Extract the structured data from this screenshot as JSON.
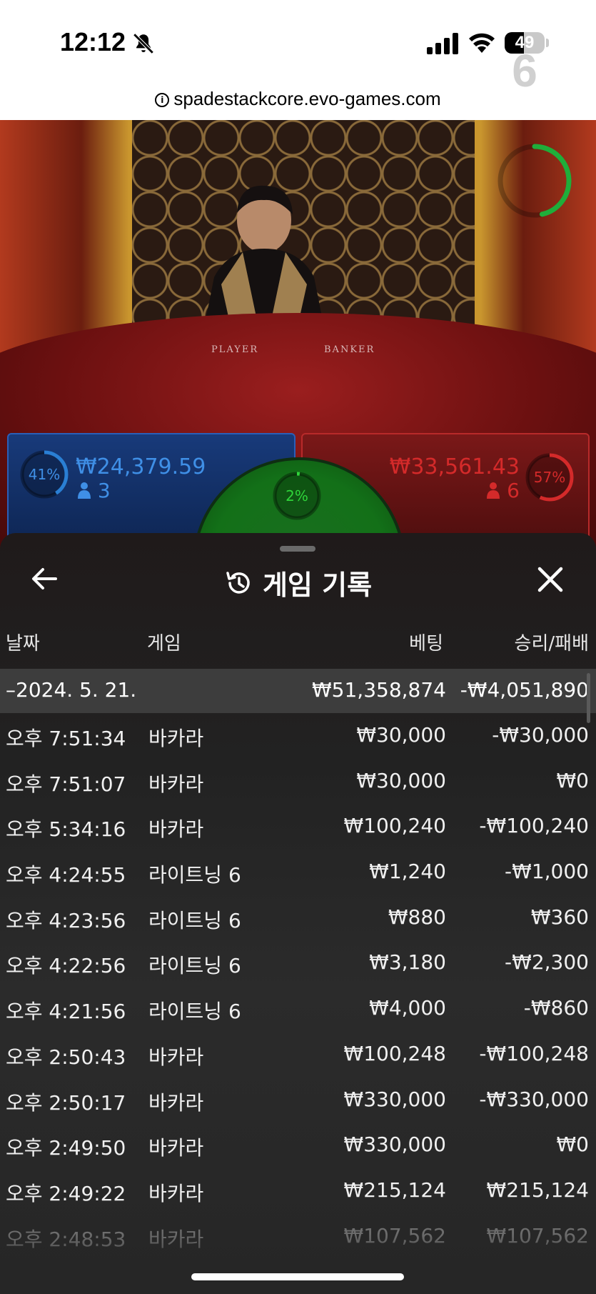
{
  "status_bar": {
    "time": "12:12",
    "battery": "49",
    "battery_level": 0.49
  },
  "browser": {
    "url": "spadestackcore.evo-games.com"
  },
  "video": {
    "countdown": "6",
    "table_labels": [
      "PLAYER",
      "BANKER"
    ]
  },
  "bets": {
    "player": {
      "percent": "41%",
      "amount": "₩24,379.59",
      "count": "3",
      "fraction": 0.41,
      "color": "#2a7fd4"
    },
    "tie": {
      "percent": "2%",
      "fraction": 0.02,
      "color": "#2fd43a"
    },
    "banker": {
      "percent": "57%",
      "amount": "₩33,561.43",
      "count": "6",
      "fraction": 0.57,
      "color": "#d42a2a"
    }
  },
  "sheet": {
    "title": "게임 기록",
    "columns": {
      "date": "날짜",
      "game": "게임",
      "bet": "베팅",
      "win_loss": "승리/패배"
    },
    "date_group": {
      "date": "–2024. 5. 21.",
      "bet_total": "₩51,358,874",
      "win_total": "-₩4,051,890"
    },
    "rows": [
      {
        "time": "오후 7:51:34",
        "game": "바카라",
        "bet": "₩30,000",
        "win": "-₩30,000"
      },
      {
        "time": "오후 7:51:07",
        "game": "바카라",
        "bet": "₩30,000",
        "win": "₩0"
      },
      {
        "time": "오후 5:34:16",
        "game": "바카라",
        "bet": "₩100,240",
        "win": "-₩100,240"
      },
      {
        "time": "오후 4:24:55",
        "game": "라이트닝 6",
        "bet": "₩1,240",
        "win": "-₩1,000"
      },
      {
        "time": "오후 4:23:56",
        "game": "라이트닝 6",
        "bet": "₩880",
        "win": "₩360"
      },
      {
        "time": "오후 4:22:56",
        "game": "라이트닝 6",
        "bet": "₩3,180",
        "win": "-₩2,300"
      },
      {
        "time": "오후 4:21:56",
        "game": "라이트닝 6",
        "bet": "₩4,000",
        "win": "-₩860"
      },
      {
        "time": "오후 2:50:43",
        "game": "바카라",
        "bet": "₩100,248",
        "win": "-₩100,248"
      },
      {
        "time": "오후 2:50:17",
        "game": "바카라",
        "bet": "₩330,000",
        "win": "-₩330,000"
      },
      {
        "time": "오후 2:49:50",
        "game": "바카라",
        "bet": "₩330,000",
        "win": "₩0"
      },
      {
        "time": "오후 2:49:22",
        "game": "바카라",
        "bet": "₩215,124",
        "win": "₩215,124"
      },
      {
        "time": "오후 2:48:53",
        "game": "바카라",
        "bet": "₩107,562",
        "win": "₩107,562"
      }
    ]
  }
}
